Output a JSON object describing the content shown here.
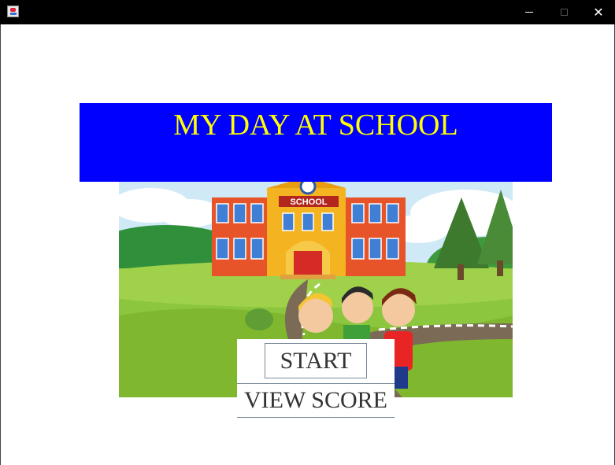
{
  "window": {
    "app_icon": "java-cup-icon",
    "controls": {
      "minimize_icon": "minimize-icon",
      "maximize_icon": "maximize-icon",
      "close_icon": "close-icon",
      "close_glyph": "✕"
    }
  },
  "banner": {
    "title": "MY DAY AT SCHOOL",
    "background": "#0000ff",
    "text_color": "#ffff00"
  },
  "scene": {
    "school_sign": "SCHOOL",
    "image": "school-illustration"
  },
  "buttons": {
    "start": "START",
    "view_score": "VIEW SCORE"
  }
}
